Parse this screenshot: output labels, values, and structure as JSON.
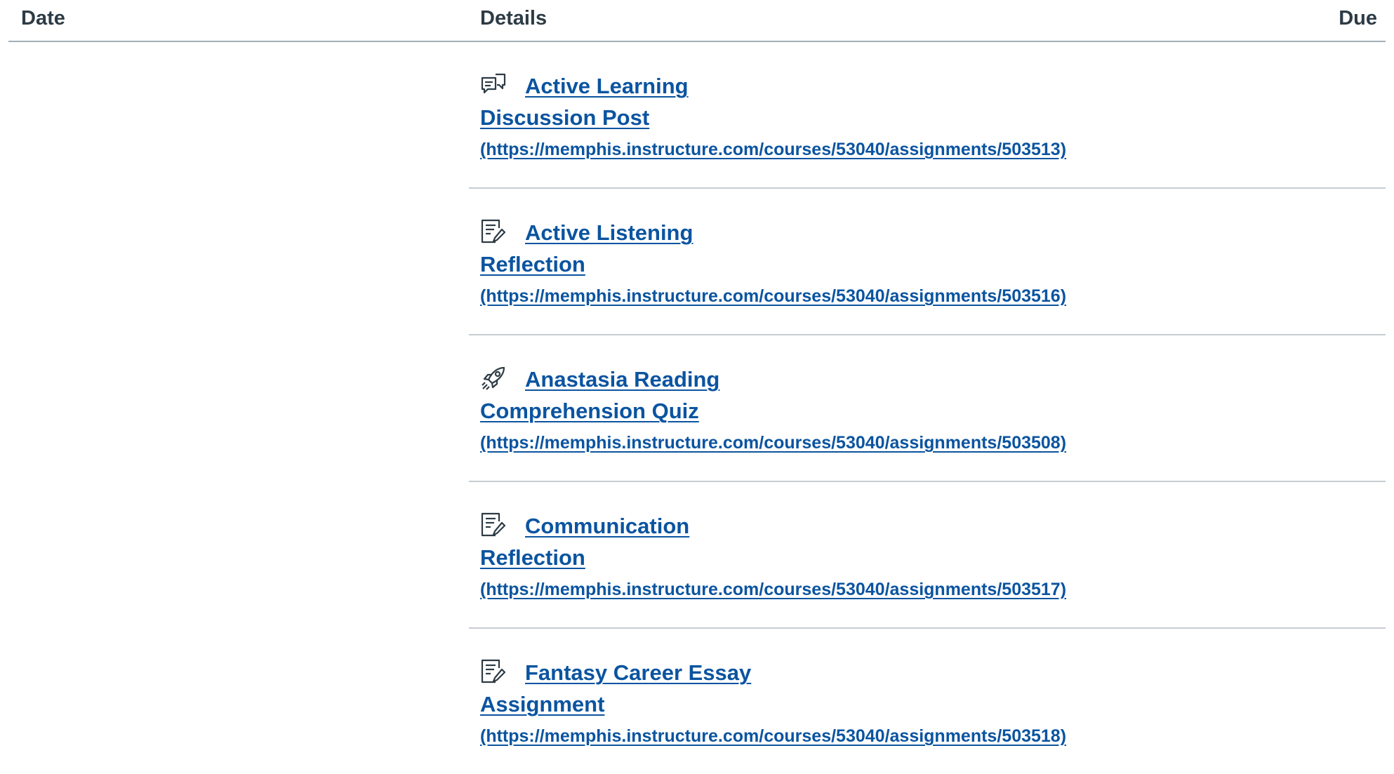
{
  "table": {
    "headers": {
      "date": "Date",
      "details": "Details",
      "due": "Due"
    }
  },
  "items": [
    {
      "icon": "discussion-icon",
      "title": "Active Learning Discussion Post",
      "url": "(https://memphis.instructure.com/courses/53040/assignments/503513)"
    },
    {
      "icon": "assignment-icon",
      "title": "Active Listening Reflection",
      "url": "(https://memphis.instructure.com/courses/53040/assignments/503516)"
    },
    {
      "icon": "quiz-rocket-icon",
      "title": "Anastasia Reading Comprehension Quiz",
      "url": "(https://memphis.instructure.com/courses/53040/assignments/503508)"
    },
    {
      "icon": "assignment-icon",
      "title": "Communication Reflection",
      "url": "(https://memphis.instructure.com/courses/53040/assignments/503517)"
    },
    {
      "icon": "assignment-icon",
      "title": "Fantasy Career Essay Assignment",
      "url": "(https://memphis.instructure.com/courses/53040/assignments/503518)"
    }
  ]
}
